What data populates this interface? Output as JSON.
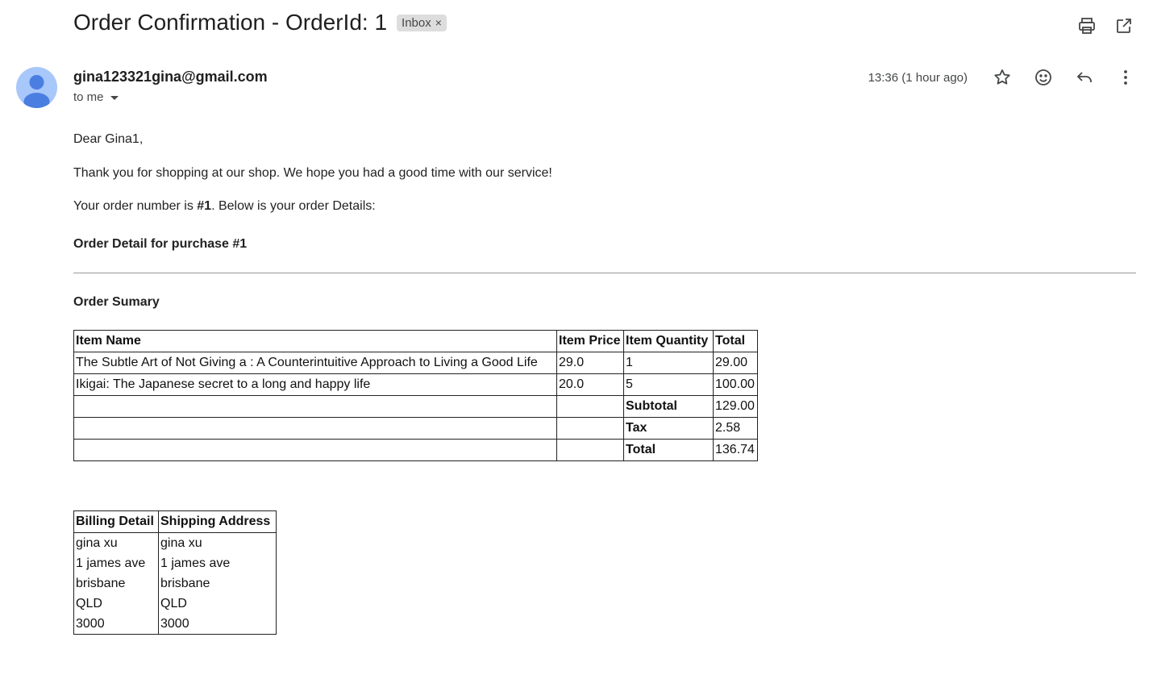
{
  "email": {
    "subject": "Order Confirmation - OrderId: 1",
    "label": "Inbox",
    "label_remove": "×",
    "sender": "gina123321gina@gmail.com",
    "to_text": "to me",
    "time": "13:36 (1 hour ago)",
    "icons": [
      "print-icon",
      "open-new-window-icon",
      "star-icon",
      "emoji-icon",
      "reply-icon",
      "more-vert-icon",
      "dropdown-caret-icon",
      "avatar-icon"
    ]
  },
  "body": {
    "greeting": "Dear Gina1,",
    "thanks": "Thank you for shopping at our shop. We hope you had a good time with our service!",
    "order_prefix": "Your order number is ",
    "order_number": "#1",
    "order_suffix": ". Below is your order Details:",
    "detail_heading": "Order Detail for purchase #1",
    "summary_heading": "Order Sumary"
  },
  "order_table": {
    "headers": [
      "Item Name",
      "Item Price",
      "Item Quantity",
      "Total"
    ],
    "rows": [
      [
        "The Subtle Art of Not Giving a : A Counterintuitive Approach to Living a Good Life",
        "29.0",
        "1",
        "29.00"
      ],
      [
        "Ikigai: The Japanese secret to a long and happy life",
        "20.0",
        "5",
        "100.00"
      ]
    ],
    "subtotal_label": "Subtotal",
    "subtotal_value": "129.00",
    "tax_label": "Tax",
    "tax_value": "2.58",
    "total_label": "Total",
    "total_value": "136.74"
  },
  "address_table": {
    "headers": [
      "Billing Detail",
      "Shipping Address"
    ],
    "billing": [
      "gina xu",
      "1 james ave",
      "brisbane",
      "QLD",
      "3000"
    ],
    "shipping": [
      "gina xu",
      "1 james ave",
      "brisbane",
      "QLD",
      "3000"
    ]
  }
}
